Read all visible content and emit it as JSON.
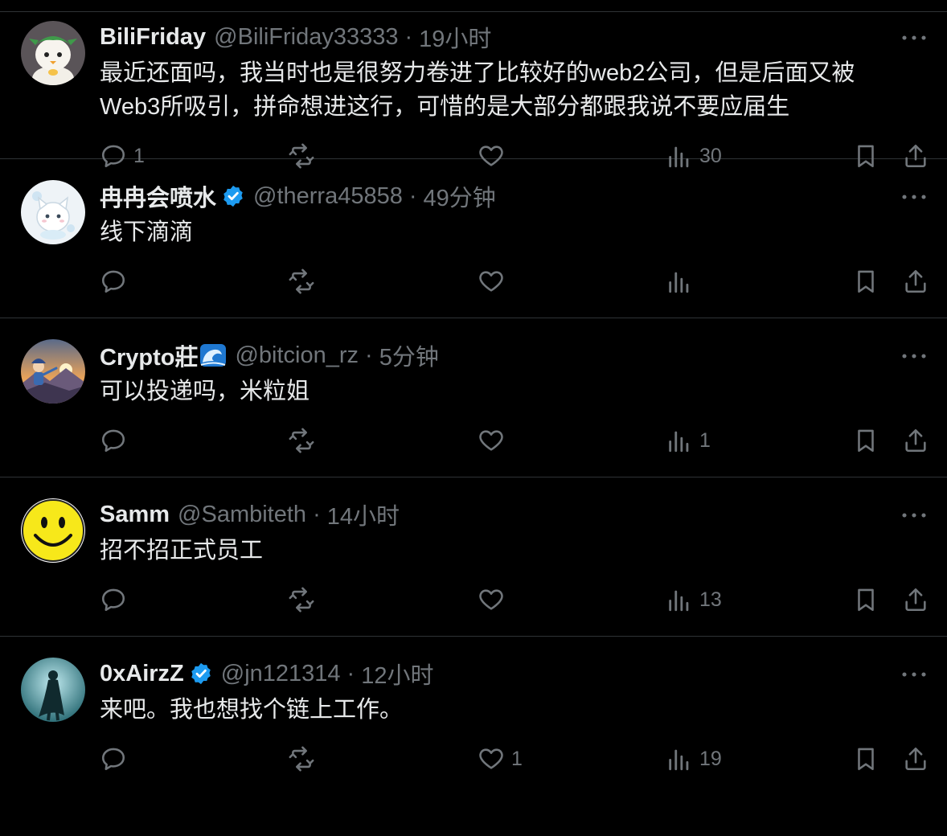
{
  "tweets": [
    {
      "display_name": "BiliFriday",
      "handle": "@BiliFriday33333",
      "time": "19小时",
      "verified": false,
      "text_lines": [
        "最近还面吗，我当时也是很努力卷进了比较好的web2公司，但是后面又被",
        "Web3所吸引，拼命想进这行，可惜的是大部分都跟我说不要应届生"
      ],
      "replies": "1",
      "retweets": "",
      "likes": "",
      "views": "30",
      "avatar_icon": "cartoon-avatar"
    },
    {
      "display_name": "冉冉会喷水",
      "handle": "@therra45858",
      "time": "49分钟",
      "verified": true,
      "text_lines": [
        "线下滴滴"
      ],
      "replies": "",
      "retweets": "",
      "likes": "",
      "views": "",
      "avatar_icon": "cat-avatar"
    },
    {
      "display_name": "Crypto莊",
      "handle": "@bitcion_rz",
      "time": "5分钟",
      "verified": false,
      "name_emoji": "wave-emoji",
      "text_lines": [
        "可以投递吗，米粒姐"
      ],
      "replies": "",
      "retweets": "",
      "likes": "",
      "views": "1",
      "avatar_icon": "landscape-avatar"
    },
    {
      "display_name": "Samm",
      "handle": "@Sambiteth",
      "time": "14小时",
      "verified": false,
      "text_lines": [
        "招不招正式员工"
      ],
      "replies": "",
      "retweets": "",
      "likes": "",
      "views": "13",
      "avatar_icon": "smiley-avatar"
    },
    {
      "display_name": "0xAirzZ",
      "handle": "@jn121314",
      "time": "12小时",
      "verified": true,
      "text_lines": [
        "来吧。我也想找个链上工作。"
      ],
      "replies": "",
      "retweets": "",
      "likes": "1",
      "views": "19",
      "avatar_icon": "caped-figure-avatar"
    }
  ],
  "separator": "·",
  "colors": {
    "background": "#000000",
    "text": "#e7e9ea",
    "muted": "#71767b",
    "divider": "#2f3336",
    "verified": "#1d9bf0"
  }
}
